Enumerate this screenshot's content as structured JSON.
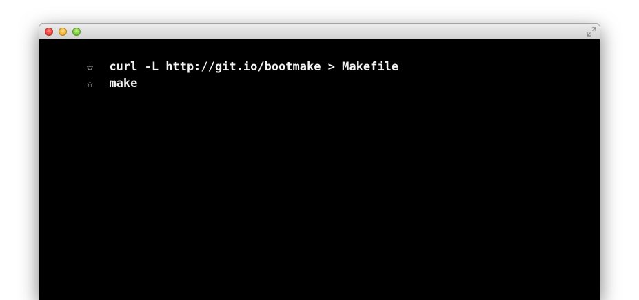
{
  "window": {
    "buttons": {
      "close": "close",
      "minimize": "minimize",
      "zoom": "zoom"
    }
  },
  "terminal": {
    "background": "#000000",
    "text_color": "#f2f2f2",
    "lines": [
      {
        "prompt": "☆",
        "command": "curl -L http://git.io/bootmake > Makefile"
      },
      {
        "prompt": "☆",
        "command": "make"
      }
    ]
  }
}
